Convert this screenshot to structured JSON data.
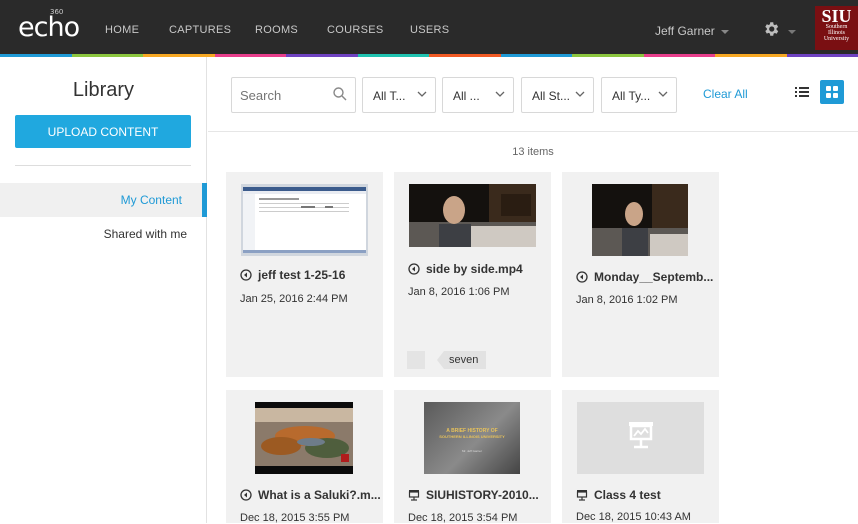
{
  "app": {
    "logo": "echo",
    "logo_sup": "360",
    "nav": [
      "HOME",
      "CAPTURES",
      "ROOMS",
      "COURSES",
      "USERS"
    ],
    "user": "Jeff Garner",
    "org": {
      "big": "SIU",
      "line1": "Southern",
      "line2": "Illinois",
      "line3": "University"
    }
  },
  "sidebar": {
    "title": "Library",
    "upload_label": "UPLOAD CONTENT",
    "items": [
      {
        "label": "My Content",
        "active": true
      },
      {
        "label": "Shared with me",
        "active": false
      }
    ]
  },
  "filters": {
    "search_placeholder": "Search",
    "dropdowns": [
      "All T...",
      "All ...",
      "All St...",
      "All Ty..."
    ],
    "clear_all": "Clear All"
  },
  "count": "13 items",
  "cards": [
    {
      "title": "jeff test 1-25-16",
      "date": "Jan 25, 2016 2:44 PM",
      "icon": "media-icon",
      "thumb": "screen"
    },
    {
      "title": "side by side.mp4",
      "date": "Jan 8, 2016 1:06 PM",
      "icon": "media-icon",
      "thumb": "person",
      "tag": "seven"
    },
    {
      "title": "Monday__Septemb...",
      "date": "Jan 8, 2016 1:02 PM",
      "icon": "media-icon",
      "thumb": "person"
    },
    {
      "title": "What is a Saluki?.m...",
      "date": "Dec 18, 2015 3:55 PM",
      "icon": "media-icon",
      "thumb": "aerial"
    },
    {
      "title": "SIUHISTORY-2010...",
      "date": "Dec 18, 2015 3:54 PM",
      "icon": "presentation-icon",
      "thumb": "slide",
      "slide_line1": "A BRIEF HISTORY OF",
      "slide_line2": "SOUTHERN ILLINOIS UNIVERSITY",
      "slide_line3": "Mr. Jeff Garner"
    },
    {
      "title": "Class 4 test",
      "date": "Dec 18, 2015 10:43 AM",
      "icon": "presentation-icon",
      "thumb": "placeholder"
    }
  ]
}
